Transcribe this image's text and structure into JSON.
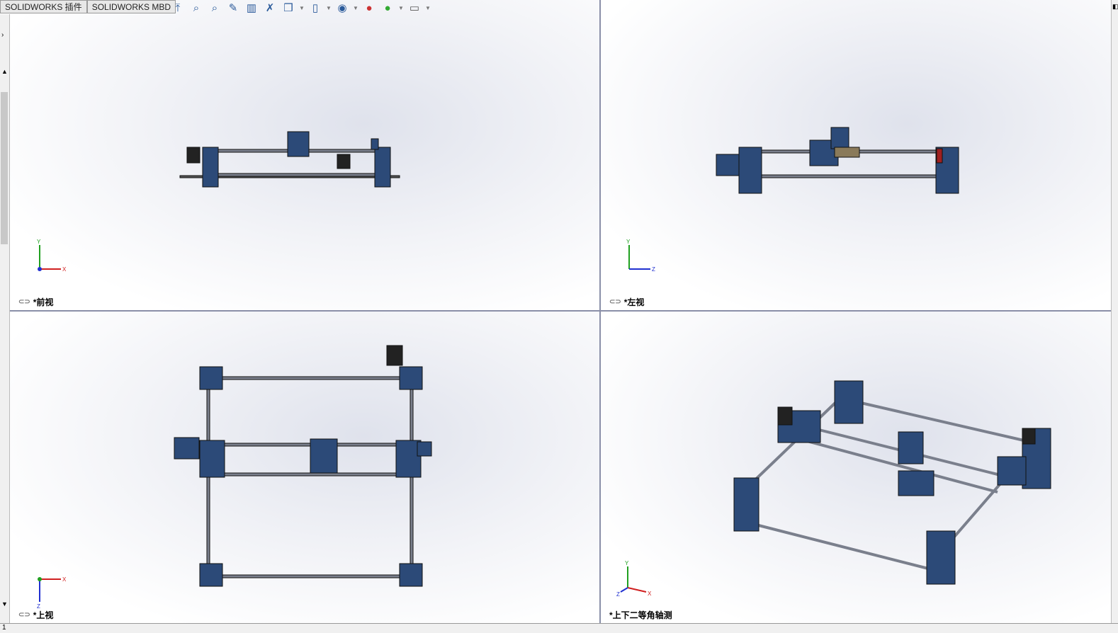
{
  "tabs": [
    {
      "label": "SOLIDWORKS 插件"
    },
    {
      "label": "SOLIDWORKS MBD"
    }
  ],
  "toolbar": {
    "icons": [
      "view-orientation-icon",
      "zoom-to-fit-icon",
      "zoom-to-area-icon",
      "previous-view-icon",
      "section-view-icon",
      "dynamic-annotation-icon",
      "view-orientation-dropdown-icon",
      "display-style-icon",
      "hide-show-icon",
      "edit-appearance-icon",
      "apply-scene-icon",
      "view-settings-icon"
    ]
  },
  "viewports": [
    {
      "label": "*前视",
      "axes": [
        "Y",
        "X"
      ]
    },
    {
      "label": "*左视",
      "axes": [
        "Y",
        "Z"
      ]
    },
    {
      "label": "*上视",
      "axes": [
        "Z",
        "X"
      ]
    },
    {
      "label": "*上下二等角轴测",
      "axes": [
        "Y",
        "Z",
        "X"
      ]
    }
  ],
  "status": {
    "page": "1"
  },
  "colors": {
    "part": "#2c4a78",
    "rod": "#7a7f8c",
    "x_axis": "#d02020",
    "y_axis": "#20a020",
    "z_axis": "#2030d0"
  }
}
